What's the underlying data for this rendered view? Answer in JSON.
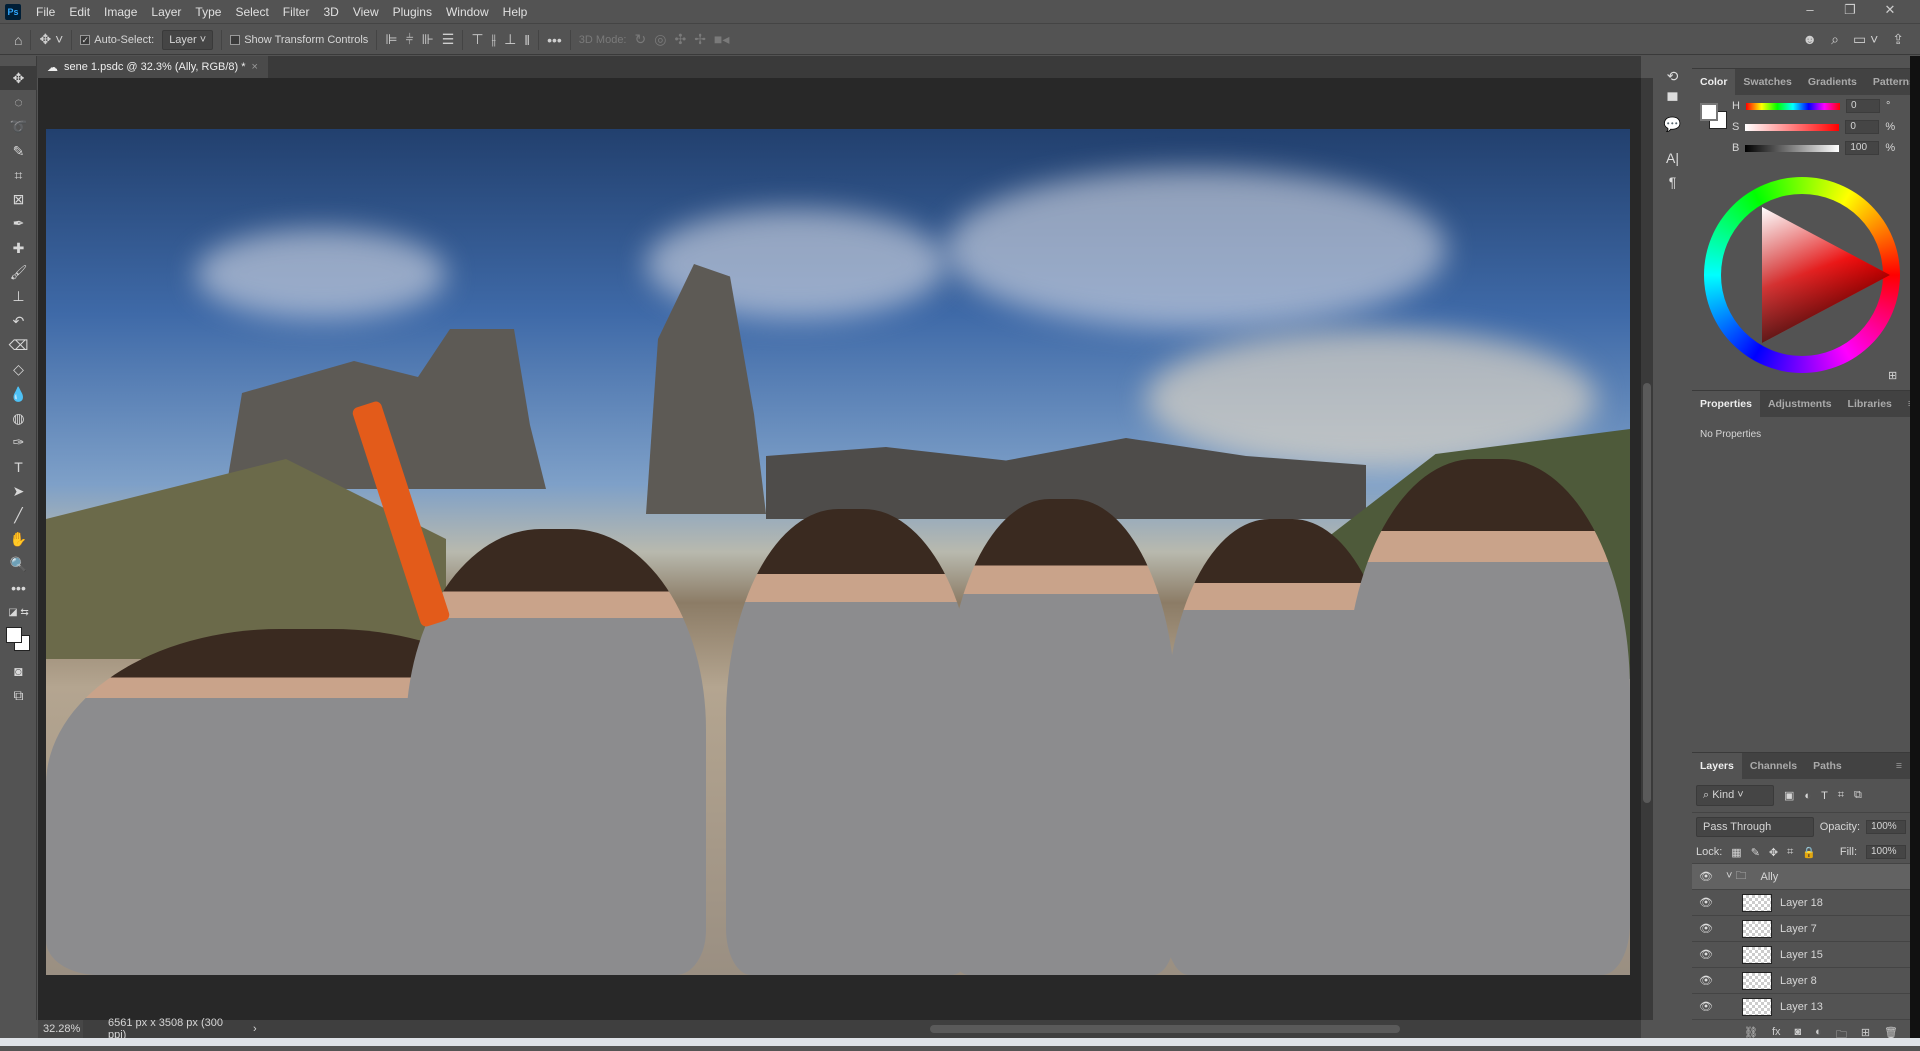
{
  "app": {
    "logo": "Ps"
  },
  "menu": [
    "File",
    "Edit",
    "Image",
    "Layer",
    "Type",
    "Select",
    "Filter",
    "3D",
    "View",
    "Plugins",
    "Window",
    "Help"
  ],
  "window_controls": {
    "minimize": "–",
    "restore": "❐",
    "close": "✕"
  },
  "options": {
    "auto_select_label": "Auto-Select:",
    "auto_select_checked": true,
    "auto_select_target": "Layer",
    "show_transform_label": "Show Transform Controls",
    "show_transform_checked": false,
    "mode_3d_label": "3D Mode:",
    "more": "•••"
  },
  "document_tab": {
    "title": "sene 1.psdc @ 32.3% (Ally, RGB/8) *",
    "close": "×"
  },
  "tools": [
    "move",
    "marquee",
    "lasso",
    "quick-select",
    "crop",
    "frame",
    "eyedropper",
    "healing",
    "brush",
    "stamp",
    "history-brush",
    "eraser",
    "paint-bucket",
    "blur",
    "sponge",
    "pen",
    "type",
    "path-select",
    "line",
    "hand",
    "zoom",
    "more"
  ],
  "status": {
    "zoom": "32.28%",
    "doc_info": "6561 px x 3508 px (300 ppi)",
    "arrow": "›"
  },
  "color_panel": {
    "tabs": [
      "Color",
      "Swatches",
      "Gradients",
      "Patterns"
    ],
    "active": "Color",
    "h_label": "H",
    "s_label": "S",
    "b_label": "B",
    "h": "0",
    "s": "0",
    "b": "100",
    "h_unit": "°",
    "s_unit": "%",
    "b_unit": "%",
    "foreground": "#ffffff",
    "background": "#ffffff"
  },
  "properties_panel": {
    "tabs": [
      "Properties",
      "Adjustments",
      "Libraries"
    ],
    "active": "Properties",
    "content": "No Properties"
  },
  "layers_panel": {
    "tabs": [
      "Layers",
      "Channels",
      "Paths"
    ],
    "active": "Layers",
    "filter": "Kind",
    "blend_mode": "Pass Through",
    "opacity_label": "Opacity:",
    "opacity": "100%",
    "lock_label": "Lock:",
    "fill_label": "Fill:",
    "fill": "100%",
    "group": {
      "name": "Ally",
      "visible": true,
      "expanded": true
    },
    "layers": [
      {
        "name": "Layer 18",
        "visible": true
      },
      {
        "name": "Layer 7",
        "visible": true
      },
      {
        "name": "Layer 15",
        "visible": true
      },
      {
        "name": "Layer 8",
        "visible": true
      },
      {
        "name": "Layer 13",
        "visible": true
      }
    ]
  }
}
